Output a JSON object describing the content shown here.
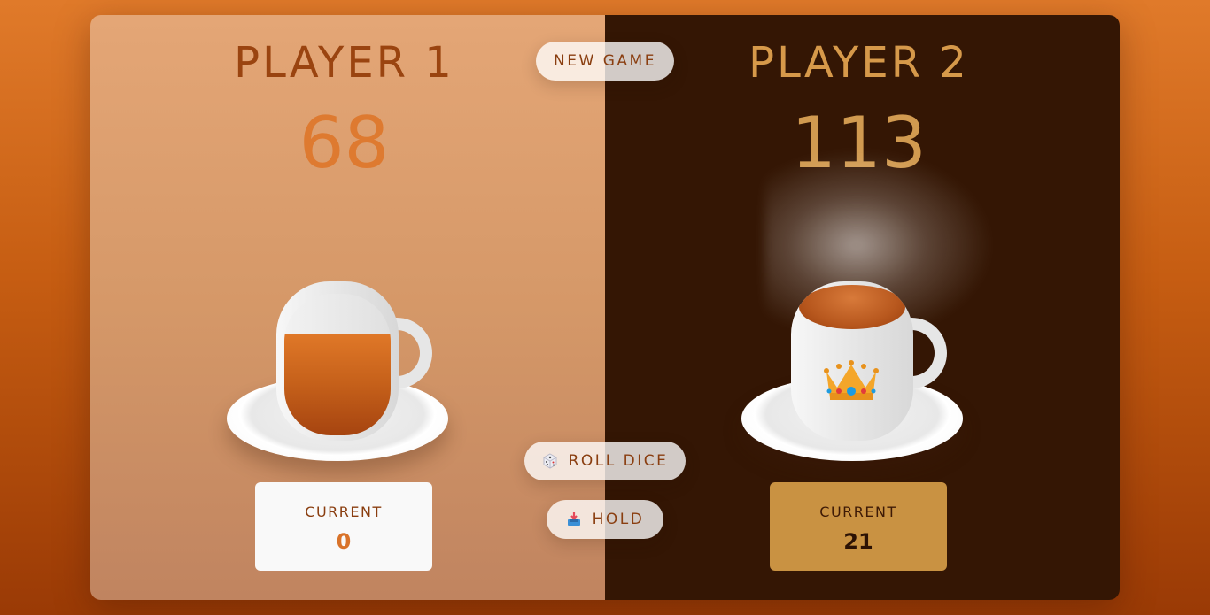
{
  "players": [
    {
      "name": "PLAYER 1",
      "score": "68",
      "current_label": "CURRENT",
      "current_value": "0",
      "tea_level_percent": 72,
      "active": false
    },
    {
      "name": "PLAYER 2",
      "score": "113",
      "current_label": "CURRENT",
      "current_value": "21",
      "winner_icon": "crown-icon",
      "active": true
    }
  ],
  "buttons": {
    "new_game": "NEW GAME",
    "roll_dice": "ROLL DICE",
    "roll_dice_icon": "dice-icon",
    "hold": "HOLD",
    "hold_icon": "inbox-tray-icon"
  },
  "colors": {
    "background": "#c65d12",
    "player1_panel": "#e4a676",
    "player2_panel": "#341604",
    "player2_current_box": "#c99242",
    "accent": "#de7a30"
  }
}
